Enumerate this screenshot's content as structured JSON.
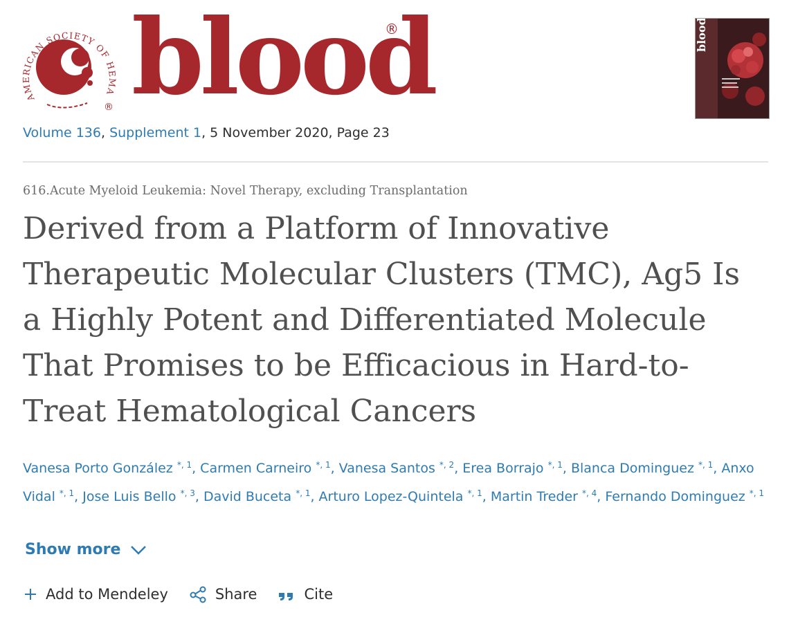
{
  "header": {
    "society_name": "AMERICAN SOCIETY OF HEMATOLOGY",
    "wordmark": "blood",
    "registered_mark": "®",
    "cover_image": "blood-journal-cover"
  },
  "issue": {
    "volume": "Volume 136",
    "supplement": "Supplement 1",
    "date_page": ", 5 November 2020, Page 23",
    "separator": ", "
  },
  "article": {
    "category": "616.Acute Myeloid Leukemia: Novel Therapy, excluding Transplantation",
    "title": "Derived from a Platform of Innovative Therapeutic Molecular Clusters (TMC), Ag5 Is a Highly Potent and Differentiated Molecule That Promises to be Efficacious in Hard-to-Treat Hematological Cancers"
  },
  "authors": [
    {
      "name": "Vanesa Porto González",
      "sup": "*, 1"
    },
    {
      "name": "Carmen Carneiro",
      "sup": "*, 1"
    },
    {
      "name": "Vanesa Santos",
      "sup": "*, 2"
    },
    {
      "name": "Erea Borrajo",
      "sup": "*, 1"
    },
    {
      "name": "Blanca Dominguez",
      "sup": "*, 1"
    },
    {
      "name": "Anxo Vidal",
      "sup": "*, 1"
    },
    {
      "name": "Jose Luis Bello",
      "sup": "*, 3"
    },
    {
      "name": "David Buceta",
      "sup": "*, 1"
    },
    {
      "name": "Arturo Lopez-Quintela",
      "sup": "*, 1"
    },
    {
      "name": "Martin Treder",
      "sup": "*, 4"
    },
    {
      "name": "Fernando Dominguez",
      "sup": "*, 1"
    }
  ],
  "show_more": {
    "label": "Show more",
    "icon": "chevron-down-icon"
  },
  "actions": {
    "mendeley": {
      "label": "Add to Mendeley",
      "icon": "plus-icon"
    },
    "share": {
      "label": "Share",
      "icon": "share-icon"
    },
    "cite": {
      "label": "Cite",
      "icon": "quote-icon"
    }
  },
  "colors": {
    "brand_red": "#a6282c",
    "link_blue": "#2e7bb4",
    "title_gray": "#505050"
  }
}
